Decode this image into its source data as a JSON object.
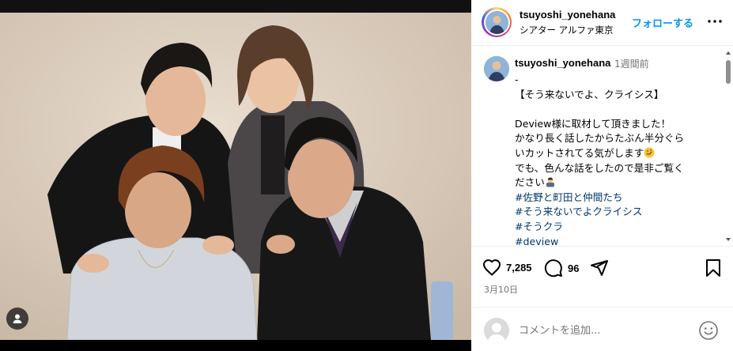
{
  "post": {
    "username": "tsuyoshi_yonehana",
    "location": "シアター アルファ東京",
    "follow_label": "フォローする",
    "caption_time": "1週間前",
    "caption_lines": [
      "-",
      "【そう来ないでよ、クライシス】",
      "",
      "Deview様に取材して頂きました！",
      "かなり長く話したからたぶん半分ぐら",
      "いカットされてる気がします",
      "でも、色んな話をしたので是非ご覧く",
      "ださい"
    ],
    "hashtags": [
      "#佐野と町田と仲間たち",
      "#そう来ないでよクライシス",
      "#そうクラ",
      "#deview"
    ],
    "likes": "7,285",
    "comments": "96",
    "date": "3月10日",
    "comment_placeholder": "コメントを追加..."
  },
  "colors": {
    "accent": "#0095f6",
    "hashtag": "#00376b",
    "muted": "#737373"
  },
  "icons": {
    "more": "more-horizontal-icon",
    "like": "heart-icon",
    "comment": "comment-bubble-icon",
    "share": "paper-plane-icon",
    "save": "bookmark-icon",
    "emoji": "smiley-icon",
    "tag_user": "person-tag-icon"
  }
}
